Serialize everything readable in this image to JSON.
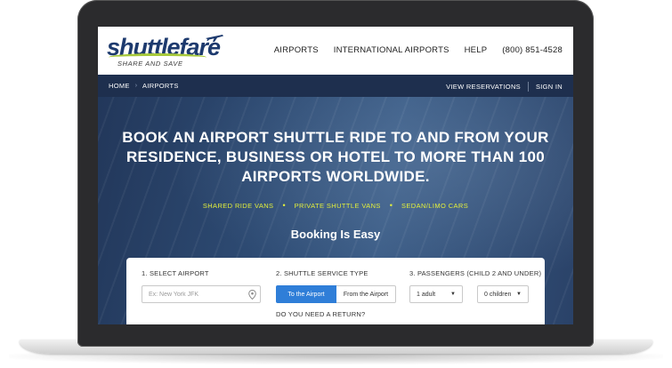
{
  "header": {
    "logo_word": "shuttlefare",
    "logo_tagline": "SHARE AND SAVE",
    "nav": [
      "AIRPORTS",
      "INTERNATIONAL AIRPORTS",
      "HELP",
      "(800) 851-4528"
    ]
  },
  "subnav": {
    "breadcrumbs": [
      "HOME",
      "AIRPORTS"
    ],
    "separator": "›",
    "view_reservations": "VIEW RESERVATIONS",
    "sign_in": "SIGN IN"
  },
  "hero": {
    "headline_lines": [
      "BOOK AN AIRPORT SHUTTLE RIDE TO AND FROM YOUR",
      "RESIDENCE, BUSINESS OR HOTEL TO MORE THAN 100",
      "AIRPORTS WORLDWIDE."
    ],
    "services": [
      "SHARED RIDE VANS",
      "PRIVATE SHUTTLE VANS",
      "SEDAN/LIMO CARS"
    ],
    "service_separator": "•",
    "booking_title": "Booking Is Easy"
  },
  "booking": {
    "step1_label": "1. SELECT AIRPORT",
    "airport_placeholder": "Ex: New York JFK",
    "step2_label": "2. SHUTTLE SERVICE TYPE",
    "to_airport": "To the Airport",
    "from_airport": "From the Airport",
    "step3_label": "3. PASSENGERS (CHILD 2 AND UNDER)",
    "adults_value": "1 adult",
    "children_value": "0 children",
    "return_question": "DO YOU NEED A RETURN?"
  },
  "colors": {
    "brand_navy": "#1d3a6e",
    "brand_green": "#a7c93a",
    "service_yellow": "#e3ef3b",
    "toggle_active": "#2f7ed8"
  },
  "icons": {
    "plane": "plane-icon",
    "pin": "map-pin-icon",
    "caret": "caret-down-icon"
  }
}
